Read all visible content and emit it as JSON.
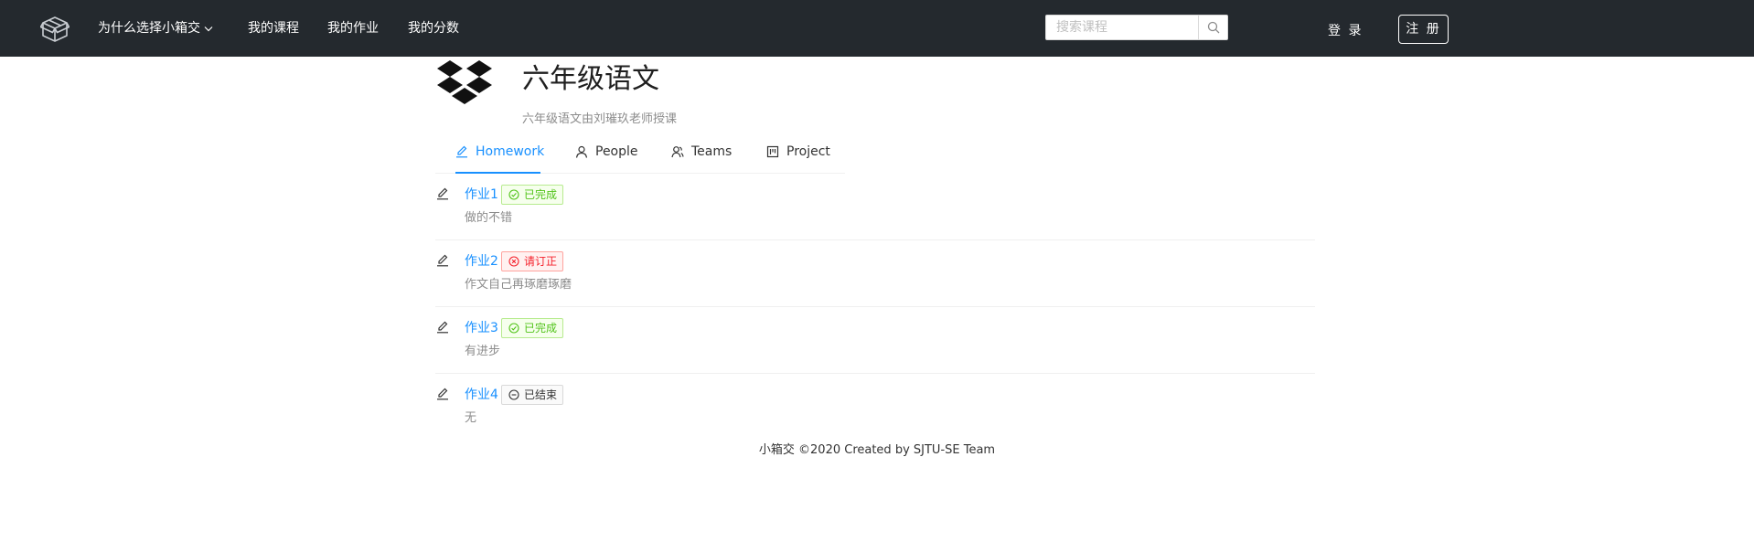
{
  "colors": {
    "topbar": "#24292e",
    "accent": "#1890ff",
    "success": "#52c41a",
    "error": "#f5222d"
  },
  "nav": {
    "logo_icon": "box-icon",
    "why": "为什么选择小箱交",
    "my_courses": "我的课程",
    "my_homework": "我的作业",
    "my_scores": "我的分数",
    "search_placeholder": "搜索课程",
    "search_icon": "search-icon",
    "login": "登 录",
    "register": "注 册"
  },
  "course": {
    "logo_icon": "dropbox-logo-icon",
    "title": "六年级语文",
    "description": "六年级语文由刘璀玖老师授课"
  },
  "tabs": [
    {
      "label": "Homework",
      "icon": "edit-icon",
      "active": true
    },
    {
      "label": "People",
      "icon": "user-icon",
      "active": false
    },
    {
      "label": "Teams",
      "icon": "team-icon",
      "active": false
    },
    {
      "label": "Project",
      "icon": "project-icon",
      "active": false
    }
  ],
  "homework": [
    {
      "title": "作业1",
      "status": "已完成",
      "status_type": "success",
      "comment": "做的不错"
    },
    {
      "title": "作业2",
      "status": "请订正",
      "status_type": "error",
      "comment": "作文自己再琢磨琢磨"
    },
    {
      "title": "作业3",
      "status": "已完成",
      "status_type": "success",
      "comment": "有进步"
    },
    {
      "title": "作业4",
      "status": "已结束",
      "status_type": "default",
      "comment": "无"
    }
  ],
  "footer": "小箱交 ©2020 Created by SJTU-SE Team"
}
